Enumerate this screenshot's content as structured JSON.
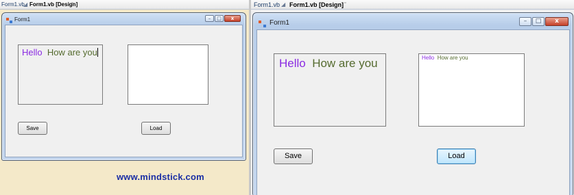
{
  "left": {
    "tabs": [
      {
        "label": "Form1.vb"
      },
      {
        "label": "Form1.vb [Design]"
      }
    ],
    "window": {
      "title": "Form1",
      "controls": {
        "minimize": "–",
        "maximize": "□",
        "close": "x"
      }
    },
    "textbox1": {
      "hello": "Hello",
      "rest": "How are you"
    },
    "textbox2": {
      "hello": "",
      "rest": ""
    },
    "save_label": "Save",
    "load_label": "Load"
  },
  "right": {
    "tabs": [
      {
        "label": "Form1.vb"
      },
      {
        "label": "Form1.vb [Design]"
      }
    ],
    "window": {
      "title": "Form1",
      "controls": {
        "minimize": "–",
        "maximize": "□",
        "close": "x"
      }
    },
    "textbox1": {
      "hello": "Hello",
      "rest": "How are you"
    },
    "textbox2": {
      "hello": "Hello",
      "rest": "How are you"
    },
    "save_label": "Save",
    "load_label": "Load"
  },
  "watermark": "www.mindstick.com",
  "colors": {
    "hello_text": "#8a2be2",
    "message_text": "#556b2f",
    "watermark": "#1b2fa5"
  }
}
